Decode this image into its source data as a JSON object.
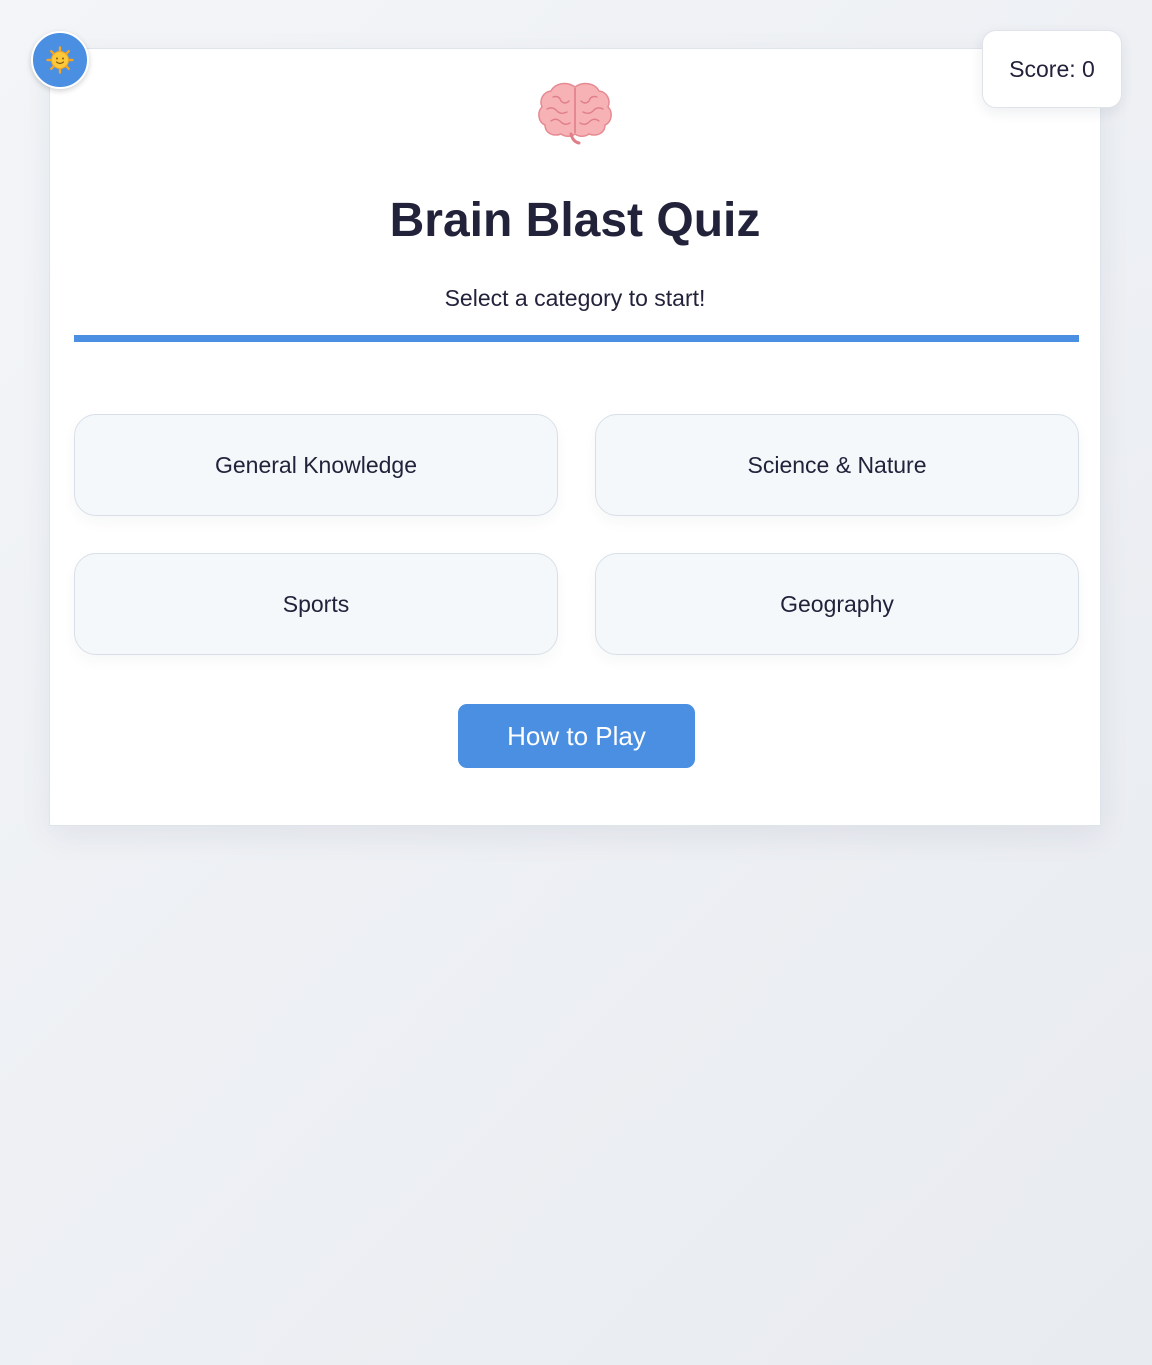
{
  "theme_toggle": {
    "icon": "sun-face-icon"
  },
  "score": {
    "label": "Score: 0"
  },
  "header": {
    "icon": "brain-icon",
    "title": "Brain Blast Quiz",
    "subtitle": "Select a category to start!"
  },
  "progress": {
    "fraction": 1.0,
    "color": "#4a8fe2"
  },
  "categories": [
    {
      "label": "General Knowledge"
    },
    {
      "label": "Science & Nature"
    },
    {
      "label": "Sports"
    },
    {
      "label": "Geography"
    }
  ],
  "how_to_play": {
    "label": "How to Play"
  },
  "colors": {
    "accent": "#4a8fe2",
    "text": "#22223b",
    "brain": "#f4a3a8"
  }
}
